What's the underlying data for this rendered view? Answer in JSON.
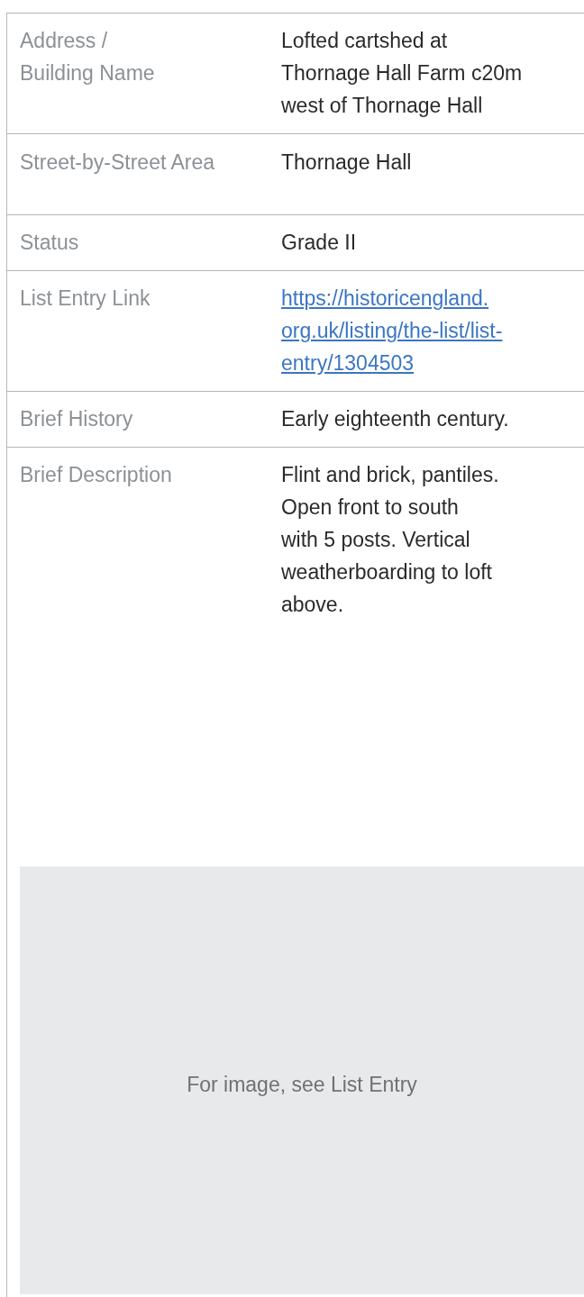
{
  "rows": [
    {
      "label": [
        "Address /",
        "Building Name"
      ],
      "value": [
        "Lofted cartshed at",
        "Thornage Hall Farm c20m",
        "west of Thornage Hall"
      ],
      "kind": "text"
    },
    {
      "label": [
        "Street-by-Street Area"
      ],
      "value": [
        "Thornage Hall"
      ],
      "kind": "text"
    },
    {
      "label": [
        "Status"
      ],
      "value": [
        "Grade II"
      ],
      "kind": "text"
    },
    {
      "label": [
        "List Entry Link"
      ],
      "value": [
        "https://historicengland.",
        "org.uk/listing/the-list/list-",
        "entry/1304503"
      ],
      "kind": "link"
    },
    {
      "label": [
        "Brief History"
      ],
      "value": [
        "Early eighteenth century."
      ],
      "kind": "text"
    },
    {
      "label": [
        "Brief Description"
      ],
      "value": [
        "Flint and brick, pantiles.",
        "Open front to south",
        "with 5 posts. Vertical",
        "weatherboarding to loft",
        "above."
      ],
      "kind": "text"
    }
  ],
  "image": {
    "kind": "picture",
    "caption": "For image, see List Entry"
  }
}
